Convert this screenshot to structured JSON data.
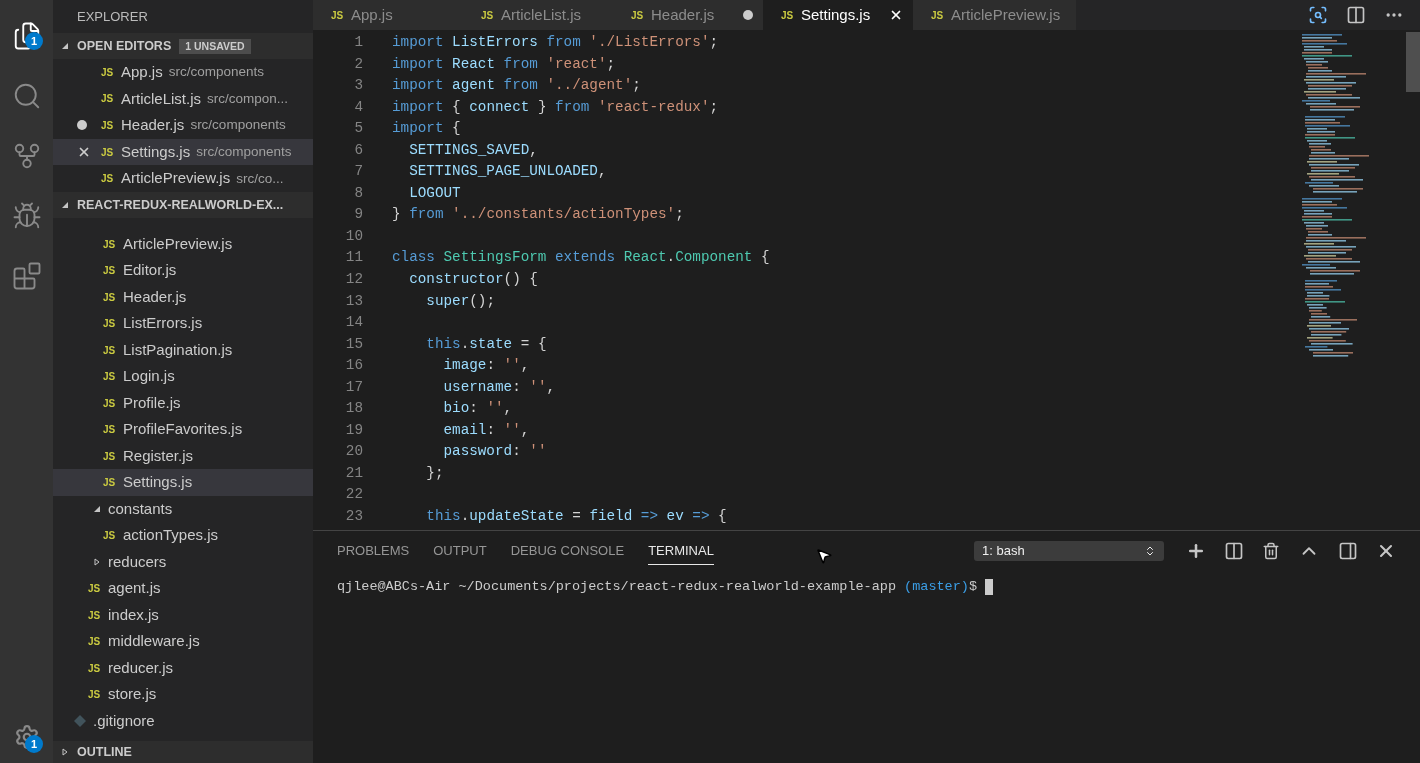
{
  "activity_bar": {
    "items": [
      {
        "kind": "files",
        "badge": "1",
        "selected": true
      },
      {
        "kind": "search",
        "selected": false
      },
      {
        "kind": "scm",
        "selected": false
      },
      {
        "kind": "debug",
        "selected": false
      },
      {
        "kind": "extensions",
        "selected": false
      }
    ],
    "settings": {
      "badge": "1"
    }
  },
  "sidebar": {
    "title": "EXPLORER",
    "open_editors": {
      "title": "OPEN EDITORS",
      "badge": "1 UNSAVED",
      "expanded": true,
      "items": [
        {
          "icon": "JS",
          "name": "App.js",
          "path": "src/components",
          "dirty": false,
          "selected": false
        },
        {
          "icon": "JS",
          "name": "ArticleList.js",
          "path": "src/compon...",
          "dirty": false,
          "selected": false
        },
        {
          "icon": "JS",
          "name": "Header.js",
          "path": "src/components",
          "dirty": true,
          "selected": false
        },
        {
          "icon": "JS",
          "name": "Settings.js",
          "path": "src/components",
          "dirty": false,
          "selected": true
        },
        {
          "icon": "JS",
          "name": "ArticlePreview.js",
          "path": "src/co...",
          "dirty": false,
          "selected": false
        }
      ]
    },
    "project": {
      "title": "REACT-REDUX-REALWORLD-EX...",
      "expanded": true,
      "tree": [
        {
          "kind": "group",
          "children": [
            {
              "kind": "group",
              "children": [
                {
                  "kind": "file",
                  "icon": "JS",
                  "name": "ArticlePreview.js",
                  "selected": false
                },
                {
                  "kind": "file",
                  "icon": "JS",
                  "name": "Editor.js",
                  "selected": false
                },
                {
                  "kind": "file",
                  "icon": "JS",
                  "name": "Header.js",
                  "selected": false
                },
                {
                  "kind": "file",
                  "icon": "JS",
                  "name": "ListErrors.js",
                  "selected": false
                },
                {
                  "kind": "file",
                  "icon": "JS",
                  "name": "ListPagination.js",
                  "selected": false
                },
                {
                  "kind": "file",
                  "icon": "JS",
                  "name": "Login.js",
                  "selected": false
                },
                {
                  "kind": "file",
                  "icon": "JS",
                  "name": "Profile.js",
                  "selected": false
                },
                {
                  "kind": "file",
                  "icon": "JS",
                  "name": "ProfileFavorites.js",
                  "selected": false
                },
                {
                  "kind": "file",
                  "icon": "JS",
                  "name": "Register.js",
                  "selected": false
                },
                {
                  "kind": "file",
                  "icon": "JS",
                  "name": "Settings.js",
                  "selected": true
                }
              ]
            },
            {
              "kind": "folder",
              "name": "constants",
              "expanded": true,
              "children": [
                {
                  "kind": "file",
                  "icon": "JS",
                  "name": "actionTypes.js",
                  "selected": false
                }
              ]
            },
            {
              "kind": "folder",
              "name": "reducers",
              "expanded": false
            },
            {
              "kind": "file",
              "icon": "JS",
              "name": "agent.js",
              "selected": false
            },
            {
              "kind": "file",
              "icon": "JS",
              "name": "index.js",
              "selected": false
            },
            {
              "kind": "file",
              "icon": "JS",
              "name": "middleware.js",
              "selected": false
            },
            {
              "kind": "file",
              "icon": "JS",
              "name": "reducer.js",
              "selected": false
            },
            {
              "kind": "file",
              "icon": "JS",
              "name": "store.js",
              "selected": false
            }
          ]
        },
        {
          "kind": "git",
          "name": ".gitignore",
          "selected": false
        }
      ]
    },
    "outline": {
      "title": "OUTLINE",
      "expanded": false
    }
  },
  "tabs": [
    {
      "icon": "JS",
      "label": "App.js",
      "selected": false,
      "dirty": false
    },
    {
      "icon": "JS",
      "label": "ArticleList.js",
      "selected": false,
      "dirty": false
    },
    {
      "icon": "JS",
      "label": "Header.js",
      "selected": false,
      "dirty": true
    },
    {
      "icon": "JS",
      "label": "Settings.js",
      "selected": true,
      "dirty": false
    },
    {
      "icon": "JS",
      "label": "ArticlePreview.js",
      "selected": false,
      "dirty": false
    }
  ],
  "code": [
    {
      "number": "1",
      "tokens": [
        {
          "text": "import ",
          "kind": "keyword"
        },
        {
          "text": "ListErrors ",
          "kind": "name"
        },
        {
          "text": "from ",
          "kind": "keyword"
        },
        {
          "text": "'./ListErrors'",
          "kind": "string"
        },
        {
          "text": ";",
          "kind": "plain"
        }
      ]
    },
    {
      "number": "2",
      "tokens": [
        {
          "text": "import ",
          "kind": "keyword"
        },
        {
          "text": "React ",
          "kind": "name"
        },
        {
          "text": "from ",
          "kind": "keyword"
        },
        {
          "text": "'react'",
          "kind": "string"
        },
        {
          "text": ";",
          "kind": "plain"
        }
      ]
    },
    {
      "number": "3",
      "tokens": [
        {
          "text": "import ",
          "kind": "keyword"
        },
        {
          "text": "agent ",
          "kind": "name"
        },
        {
          "text": "from ",
          "kind": "keyword"
        },
        {
          "text": "'../agent'",
          "kind": "string"
        },
        {
          "text": ";",
          "kind": "plain"
        }
      ]
    },
    {
      "number": "4",
      "tokens": [
        {
          "text": "import ",
          "kind": "keyword"
        },
        {
          "text": "{ ",
          "kind": "plain"
        },
        {
          "text": "connect ",
          "kind": "name"
        },
        {
          "text": "} ",
          "kind": "plain"
        },
        {
          "text": "from ",
          "kind": "keyword"
        },
        {
          "text": "'react-redux'",
          "kind": "string"
        },
        {
          "text": ";",
          "kind": "plain"
        }
      ]
    },
    {
      "number": "5",
      "tokens": [
        {
          "text": "import ",
          "kind": "keyword"
        },
        {
          "text": "{",
          "kind": "plain"
        }
      ]
    },
    {
      "number": "6",
      "tokens": [
        {
          "text": "  SETTINGS_SAVED",
          "kind": "name"
        },
        {
          "text": ",",
          "kind": "plain"
        }
      ]
    },
    {
      "number": "7",
      "tokens": [
        {
          "text": "  SETTINGS_PAGE_UNLOADED",
          "kind": "name"
        },
        {
          "text": ",",
          "kind": "plain"
        }
      ]
    },
    {
      "number": "8",
      "tokens": [
        {
          "text": "  LOGOUT",
          "kind": "name"
        }
      ]
    },
    {
      "number": "9",
      "tokens": [
        {
          "text": "} ",
          "kind": "plain"
        },
        {
          "text": "from ",
          "kind": "keyword"
        },
        {
          "text": "'../constants/actionTypes'",
          "kind": "string"
        },
        {
          "text": ";",
          "kind": "plain"
        }
      ]
    },
    {
      "number": "10"
    },
    {
      "number": "11",
      "tokens": [
        {
          "text": "class ",
          "kind": "keyword"
        },
        {
          "text": "SettingsForm ",
          "kind": "type"
        },
        {
          "text": "extends ",
          "kind": "keyword"
        },
        {
          "text": "React",
          "kind": "type"
        },
        {
          "text": ".",
          "kind": "plain"
        },
        {
          "text": "Component ",
          "kind": "type"
        },
        {
          "text": "{",
          "kind": "plain"
        }
      ]
    },
    {
      "number": "12",
      "tokens": [
        {
          "text": "  constructor",
          "kind": "name"
        },
        {
          "text": "() {",
          "kind": "plain"
        }
      ]
    },
    {
      "number": "13",
      "tokens": [
        {
          "text": "    super",
          "kind": "name"
        },
        {
          "text": "();",
          "kind": "plain"
        }
      ]
    },
    {
      "number": "14"
    },
    {
      "number": "15",
      "tokens": [
        {
          "text": "    this",
          "kind": "keyword"
        },
        {
          "text": ".",
          "kind": "plain"
        },
        {
          "text": "state ",
          "kind": "name"
        },
        {
          "text": "= {",
          "kind": "plain"
        }
      ]
    },
    {
      "number": "16",
      "tokens": [
        {
          "text": "      image",
          "kind": "name"
        },
        {
          "text": ": ",
          "kind": "plain"
        },
        {
          "text": "''",
          "kind": "string"
        },
        {
          "text": ",",
          "kind": "plain"
        }
      ]
    },
    {
      "number": "17",
      "tokens": [
        {
          "text": "      username",
          "kind": "name"
        },
        {
          "text": ": ",
          "kind": "plain"
        },
        {
          "text": "''",
          "kind": "string"
        },
        {
          "text": ",",
          "kind": "plain"
        }
      ]
    },
    {
      "number": "18",
      "tokens": [
        {
          "text": "      bio",
          "kind": "name"
        },
        {
          "text": ": ",
          "kind": "plain"
        },
        {
          "text": "''",
          "kind": "string"
        },
        {
          "text": ",",
          "kind": "plain"
        }
      ]
    },
    {
      "number": "19",
      "tokens": [
        {
          "text": "      email",
          "kind": "name"
        },
        {
          "text": ": ",
          "kind": "plain"
        },
        {
          "text": "''",
          "kind": "string"
        },
        {
          "text": ",",
          "kind": "plain"
        }
      ]
    },
    {
      "number": "20",
      "tokens": [
        {
          "text": "      password",
          "kind": "name"
        },
        {
          "text": ": ",
          "kind": "plain"
        },
        {
          "text": "''",
          "kind": "string"
        }
      ]
    },
    {
      "number": "21",
      "tokens": [
        {
          "text": "    };",
          "kind": "plain"
        }
      ]
    },
    {
      "number": "22"
    },
    {
      "number": "23",
      "tokens": [
        {
          "text": "    this",
          "kind": "keyword"
        },
        {
          "text": ".",
          "kind": "plain"
        },
        {
          "text": "updateState ",
          "kind": "name"
        },
        {
          "text": "= ",
          "kind": "plain"
        },
        {
          "text": "field ",
          "kind": "name"
        },
        {
          "text": "=> ",
          "kind": "keyword"
        },
        {
          "text": "ev ",
          "kind": "name"
        },
        {
          "text": "=> ",
          "kind": "keyword"
        },
        {
          "text": "{",
          "kind": "plain"
        }
      ]
    }
  ],
  "panel": {
    "tabs": [
      {
        "label": "PROBLEMS",
        "selected": false
      },
      {
        "label": "OUTPUT",
        "selected": false
      },
      {
        "label": "DEBUG CONSOLE",
        "selected": false
      },
      {
        "label": "TERMINAL",
        "selected": true
      }
    ],
    "terminal_select": {
      "value": "1: bash"
    },
    "terminal_line": [
      {
        "text": "qjlee@ABCs-Air ~/Documents/projects/react-redux-realworld-example-app ",
        "kind": "plain"
      },
      {
        "text": "(master)",
        "kind": "branch"
      },
      {
        "text": "$ ",
        "kind": "plain"
      }
    ]
  }
}
